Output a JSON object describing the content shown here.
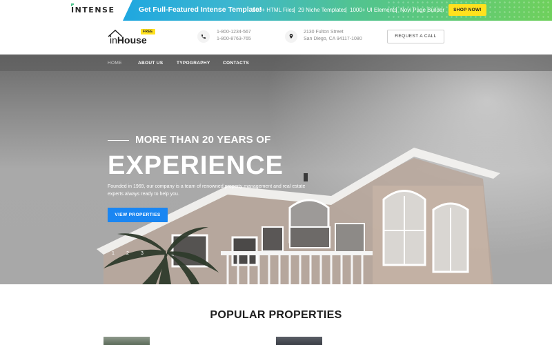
{
  "promo": {
    "brand": "INTENSE",
    "headline": "Get Full-Featured Intense Template!",
    "features": [
      "500+ HTML Files",
      "29 Niche Templates",
      "1000+ UI Elements",
      "Novi Page Builder"
    ],
    "shop_label": "SHOP NOW!",
    "accent_color": "#52c48f",
    "shop_color": "#ffe11e"
  },
  "header": {
    "logo_prefix": "in",
    "logo_name": "House",
    "logo_badge": "FREE",
    "phone_icon": "phone-icon",
    "phones": [
      "1-800-1234-567",
      "1-800-8763-765"
    ],
    "location_icon": "location-pin-icon",
    "address": [
      "2130 Fulton Street",
      "San Diego, CA 94117-1080"
    ],
    "request_call_label": "REQUEST A CALL"
  },
  "nav": {
    "items": [
      {
        "label": "HOME",
        "active": true
      },
      {
        "label": "ABOUT US",
        "active": false
      },
      {
        "label": "TYPOGRAPHY",
        "active": false
      },
      {
        "label": "CONTACTS",
        "active": false
      }
    ]
  },
  "hero": {
    "subtitle": "MORE THAN 20 YEARS OF",
    "title": "EXPERIENCE",
    "description": "Founded in 1969, our company is a team of renowned property management and real estate experts always ready to help you.",
    "button_label": "VIEW PROPERTIES",
    "button_color": "#1a86f2",
    "pager": [
      "1",
      "2",
      "3"
    ]
  },
  "popular": {
    "title": "POPULAR PROPERTIES"
  }
}
